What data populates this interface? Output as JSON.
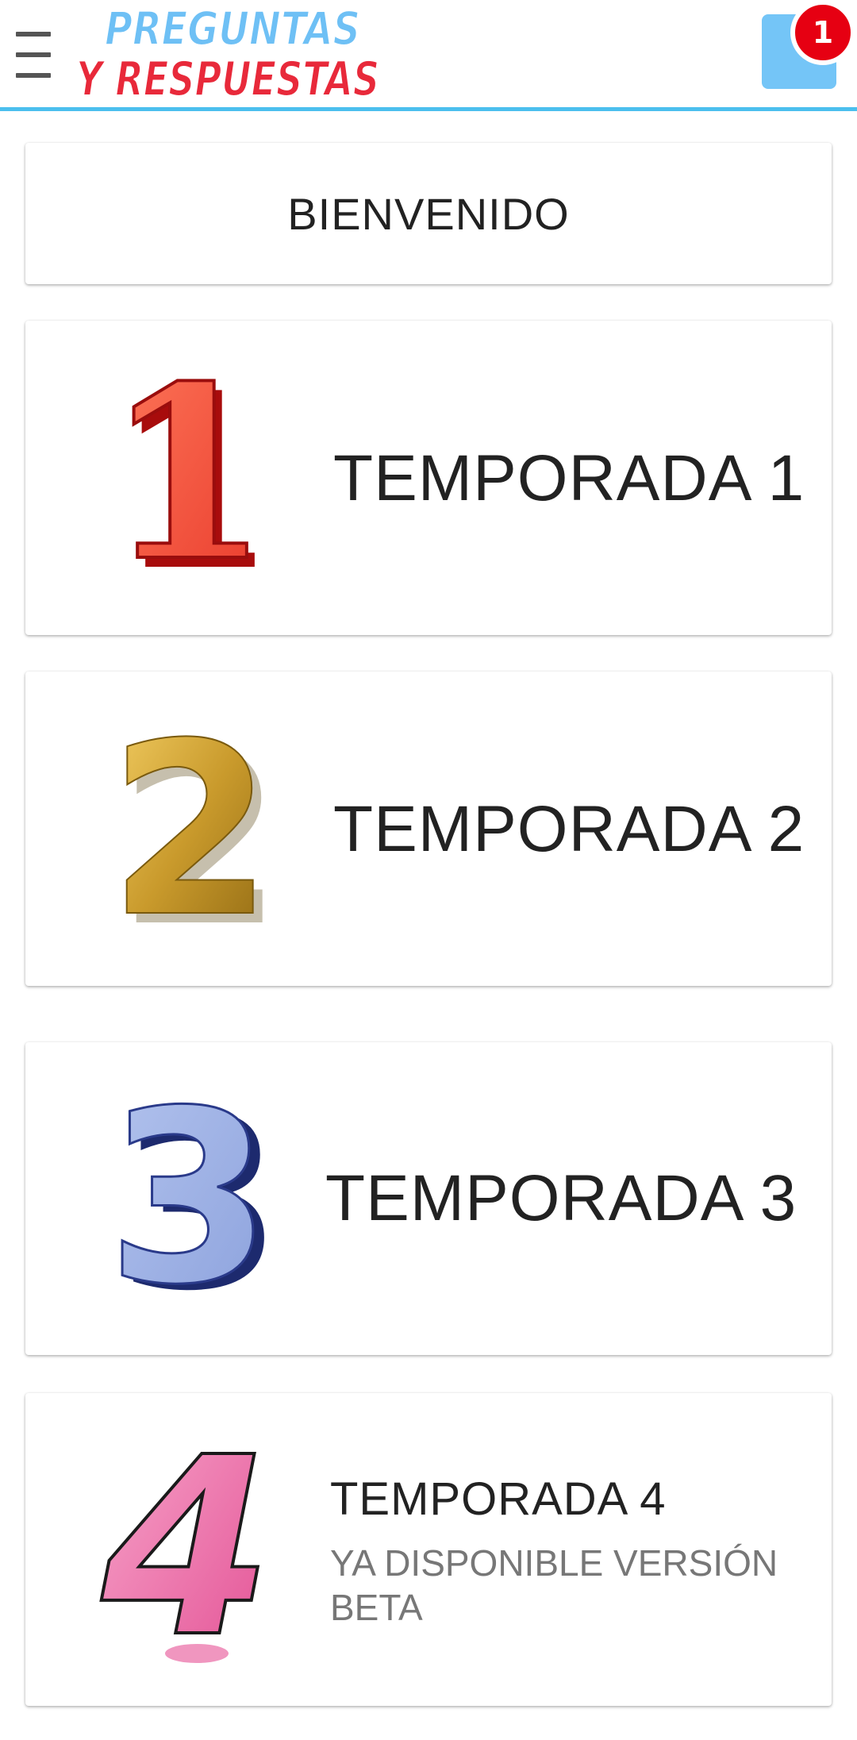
{
  "header": {
    "logo_line1": "PREGUNTAS",
    "logo_line2": "Y RESPUESTAS",
    "notification_count": "1",
    "colors": {
      "accent_line": "#4bbfee",
      "logo_blue": "#6ec0f5",
      "logo_red": "#e8293a",
      "badge": "#e60012",
      "notification_box": "#74c5f7"
    }
  },
  "welcome": {
    "label": "BIENVENIDO"
  },
  "seasons": [
    {
      "number": "1",
      "title": "TEMPORADA 1",
      "icon": "red-number-one-icon"
    },
    {
      "number": "2",
      "title": "TEMPORADA 2",
      "icon": "gold-number-two-icon"
    },
    {
      "number": "3",
      "title": "TEMPORADA 3",
      "icon": "blue-number-three-icon"
    },
    {
      "number": "4",
      "title": "TEMPORADA 4",
      "subtitle": "YA DISPONIBLE VERSIÓN BETA",
      "icon": "pink-number-four-icon"
    }
  ]
}
